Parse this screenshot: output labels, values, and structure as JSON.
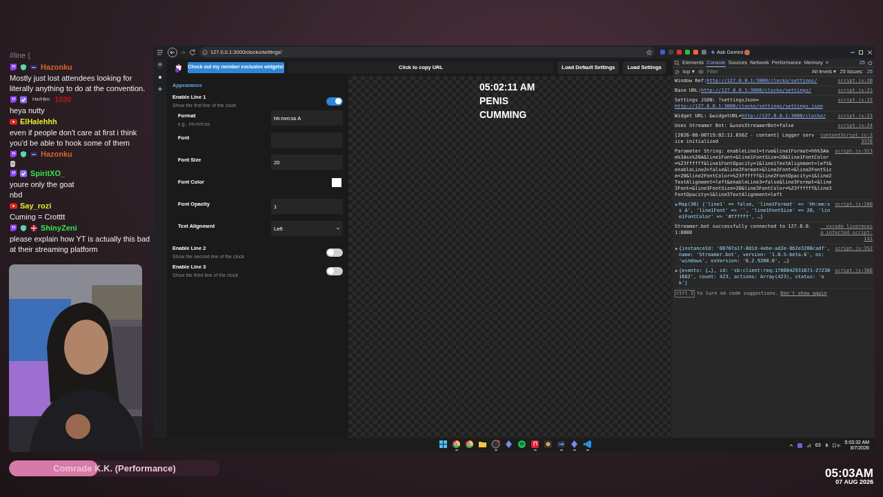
{
  "chat": {
    "header": "#line {",
    "messages": [
      {
        "name": "Hazonku",
        "color": "#d9632b",
        "lines": [
          "Mostly just lost attendees looking for literally anything to do at the convention."
        ]
      },
      {
        "pronouns": "He/Him",
        "name": "1030",
        "color": "#c0161a",
        "lines": [
          "heya nutty"
        ]
      },
      {
        "name": "ElHalehhh",
        "color": "#e6e62e",
        "lines": [
          "even if people don't care at first i think you'd be able to hook some of them"
        ]
      },
      {
        "name": "Hazonku",
        "color": "#d9632b"
      },
      {
        "name": "SpiritXO_",
        "color": "#39e04a",
        "lines": [
          "youre only the goat",
          "nbd"
        ]
      },
      {
        "name": "Say_rozi",
        "color": "#e6e62e",
        "lines": [
          "Cuming = Crotttt"
        ]
      },
      {
        "name": "ShinyZeni",
        "color": "#39e04a",
        "lines": [
          "please explain how YT is actually this bad at their streaming platform"
        ]
      }
    ]
  },
  "progress": {
    "label": "Comrade K.K. (Performance)",
    "level": 0.42
  },
  "stream_clock": {
    "time": "05:03AM",
    "date": "07 AUG 2026"
  },
  "browser": {
    "url": "127.0.0.1:3000/clocko/settings/",
    "gemini": "Ask Gemini",
    "header": {
      "promo_button": "Check out my member exclusive widgets!",
      "copy_label": "Click to copy URL",
      "buttons": [
        "Load Default Settings",
        "Load Settings"
      ]
    },
    "settings": {
      "section": "Appearance",
      "rows": [
        {
          "kind": "toggle",
          "label": "Enable Line 1",
          "hint": "Show the first line of the clock",
          "on": true,
          "children": [
            {
              "kind": "text",
              "label": "Format",
              "hint": "e.g., hh:mm:ss",
              "value": "hh:mm:ss A"
            },
            {
              "kind": "text",
              "label": "Font"
            },
            {
              "kind": "text",
              "label": "Font Size",
              "value": "20"
            },
            {
              "kind": "color",
              "label": "Font Color",
              "color": "#ffffff"
            },
            {
              "kind": "text",
              "label": "Font Opacity",
              "value": "1"
            },
            {
              "kind": "select",
              "label": "Text Alignment",
              "value": "Left"
            }
          ]
        },
        {
          "kind": "toggle",
          "label": "Enable Line 2",
          "hint": "Show the second line of the clock",
          "on": false
        },
        {
          "kind": "toggle",
          "label": "Enable Line 3",
          "hint": "Show the third line of the clock",
          "on": false
        }
      ]
    },
    "preview": {
      "lines": [
        "05:02:11 AM",
        "PENIS",
        "CUMMING"
      ]
    }
  },
  "devtools": {
    "tabs": [
      {
        "label": "Elements",
        "selected": false
      },
      {
        "label": "Console",
        "selected": true
      },
      {
        "label": "Sources",
        "selected": false
      },
      {
        "label": "Network",
        "selected": false
      },
      {
        "label": "Performance",
        "selected": false
      },
      {
        "label": "Memory",
        "selected": false
      },
      {
        "label": "»",
        "selected": false
      }
    ],
    "error_count": "25",
    "context": "top ▾",
    "filter_placeholder": "Filter",
    "levels": "All levels ▾",
    "issues": "25 Issues:",
    "issues_count": "25",
    "console": [
      {
        "kind": "log",
        "text": "Window Ref: ",
        "link": "http://127.0.0.1:3000/clocko/settings/",
        "source": "script.js:20"
      },
      {
        "kind": "log",
        "text": "Base URL: ",
        "link": "http://127.0.0.1:3000/clocko/settings/",
        "source": "script.js:21"
      },
      {
        "kind": "log",
        "text": "Settings JSON: ?settingsJson=",
        "link": "http://127.0.0.1:3000/clocko/settings/settings.json",
        "source": "script.js:22"
      },
      {
        "kind": "log",
        "text": "Widget URL: &widgetURL=",
        "link": "http://127.0.0.1:3000/clocko/",
        "source": "script.js:23"
      },
      {
        "kind": "log",
        "text": "Uses Streamer Bot: &usesStreamerBot=false",
        "source": "script.js:24"
      },
      {
        "kind": "log",
        "text": "[2026-08-06T19:02:11.656Z - content] Logger service initialized",
        "source": "contentScript.js:23376"
      },
      {
        "kind": "log",
        "text": "Parameter String: enableLine1=true&line1Format=hh%3Amm%3Ass%20A&line1Font=&line1FontSize=20&line1FontColor=%23ffffff&line1FontOpacity=1&line1TextAlignment=left&enableLine2=false&line2Format=&line2Font=&line2FontSize=20&line2FontColor=%23ffffff&line2FontOpacity=1&line2TextAlignment=left&enableLine3=false&line3Format=&line3Font=&line3FontSize=20&line3FontColor=%23ffffff&line3FontOpacity=1&line3TextAlignment=left",
        "source": "script.js:313"
      },
      {
        "kind": "object",
        "text": "Map(30) {'line1' => false, 'line1Format' => 'hh:mm:ss A', 'line1Font' => '', 'line1FontSize' => 20, 'line1FontColor' => '#ffffff', …}",
        "source": "script.js:280"
      },
      {
        "kind": "log",
        "text": "Streamer.bot successfully connected to 127.0.0.1:8080",
        "source": "__vscode_livereveia_infected_script:141"
      },
      {
        "kind": "object",
        "text": "{instanceId: '08707a17-0d1d-4ebe-ad2e-8b2e3206cadf', name: 'Streamer.bot', version: '1.0.5-beta.6', os: 'windows', osVersion: '6.2.9200.0', …}",
        "source": "script.js:352"
      },
      {
        "kind": "object",
        "text": "{events: {…}, id: 'sb:client:req:1786042931671-272301682', count: 423, actions: Array(423), status: 'ok'}",
        "source": "script.js:366"
      }
    ],
    "hint_key": "ctrl I",
    "hint": "to turn on code suggestions.",
    "hint_link": "Don't show again"
  },
  "taskbar": {
    "apps": [
      {
        "kind": "windows",
        "running": false
      },
      {
        "kind": "chrome",
        "running": true
      },
      {
        "kind": "chrome",
        "running": false
      },
      {
        "kind": "folder",
        "running": false
      },
      {
        "kind": "obs",
        "running": true
      },
      {
        "kind": "diamond",
        "running": false
      },
      {
        "kind": "spotify",
        "running": false
      },
      {
        "kind": "music",
        "running": true
      },
      {
        "kind": "resolve",
        "running": false
      },
      {
        "kind": "bridge",
        "running": true
      },
      {
        "kind": "diamond",
        "running": true
      },
      {
        "kind": "code",
        "running": true
      }
    ],
    "tray_number": "63",
    "time": "5:03:32 AM",
    "date": "8/7/2026"
  }
}
